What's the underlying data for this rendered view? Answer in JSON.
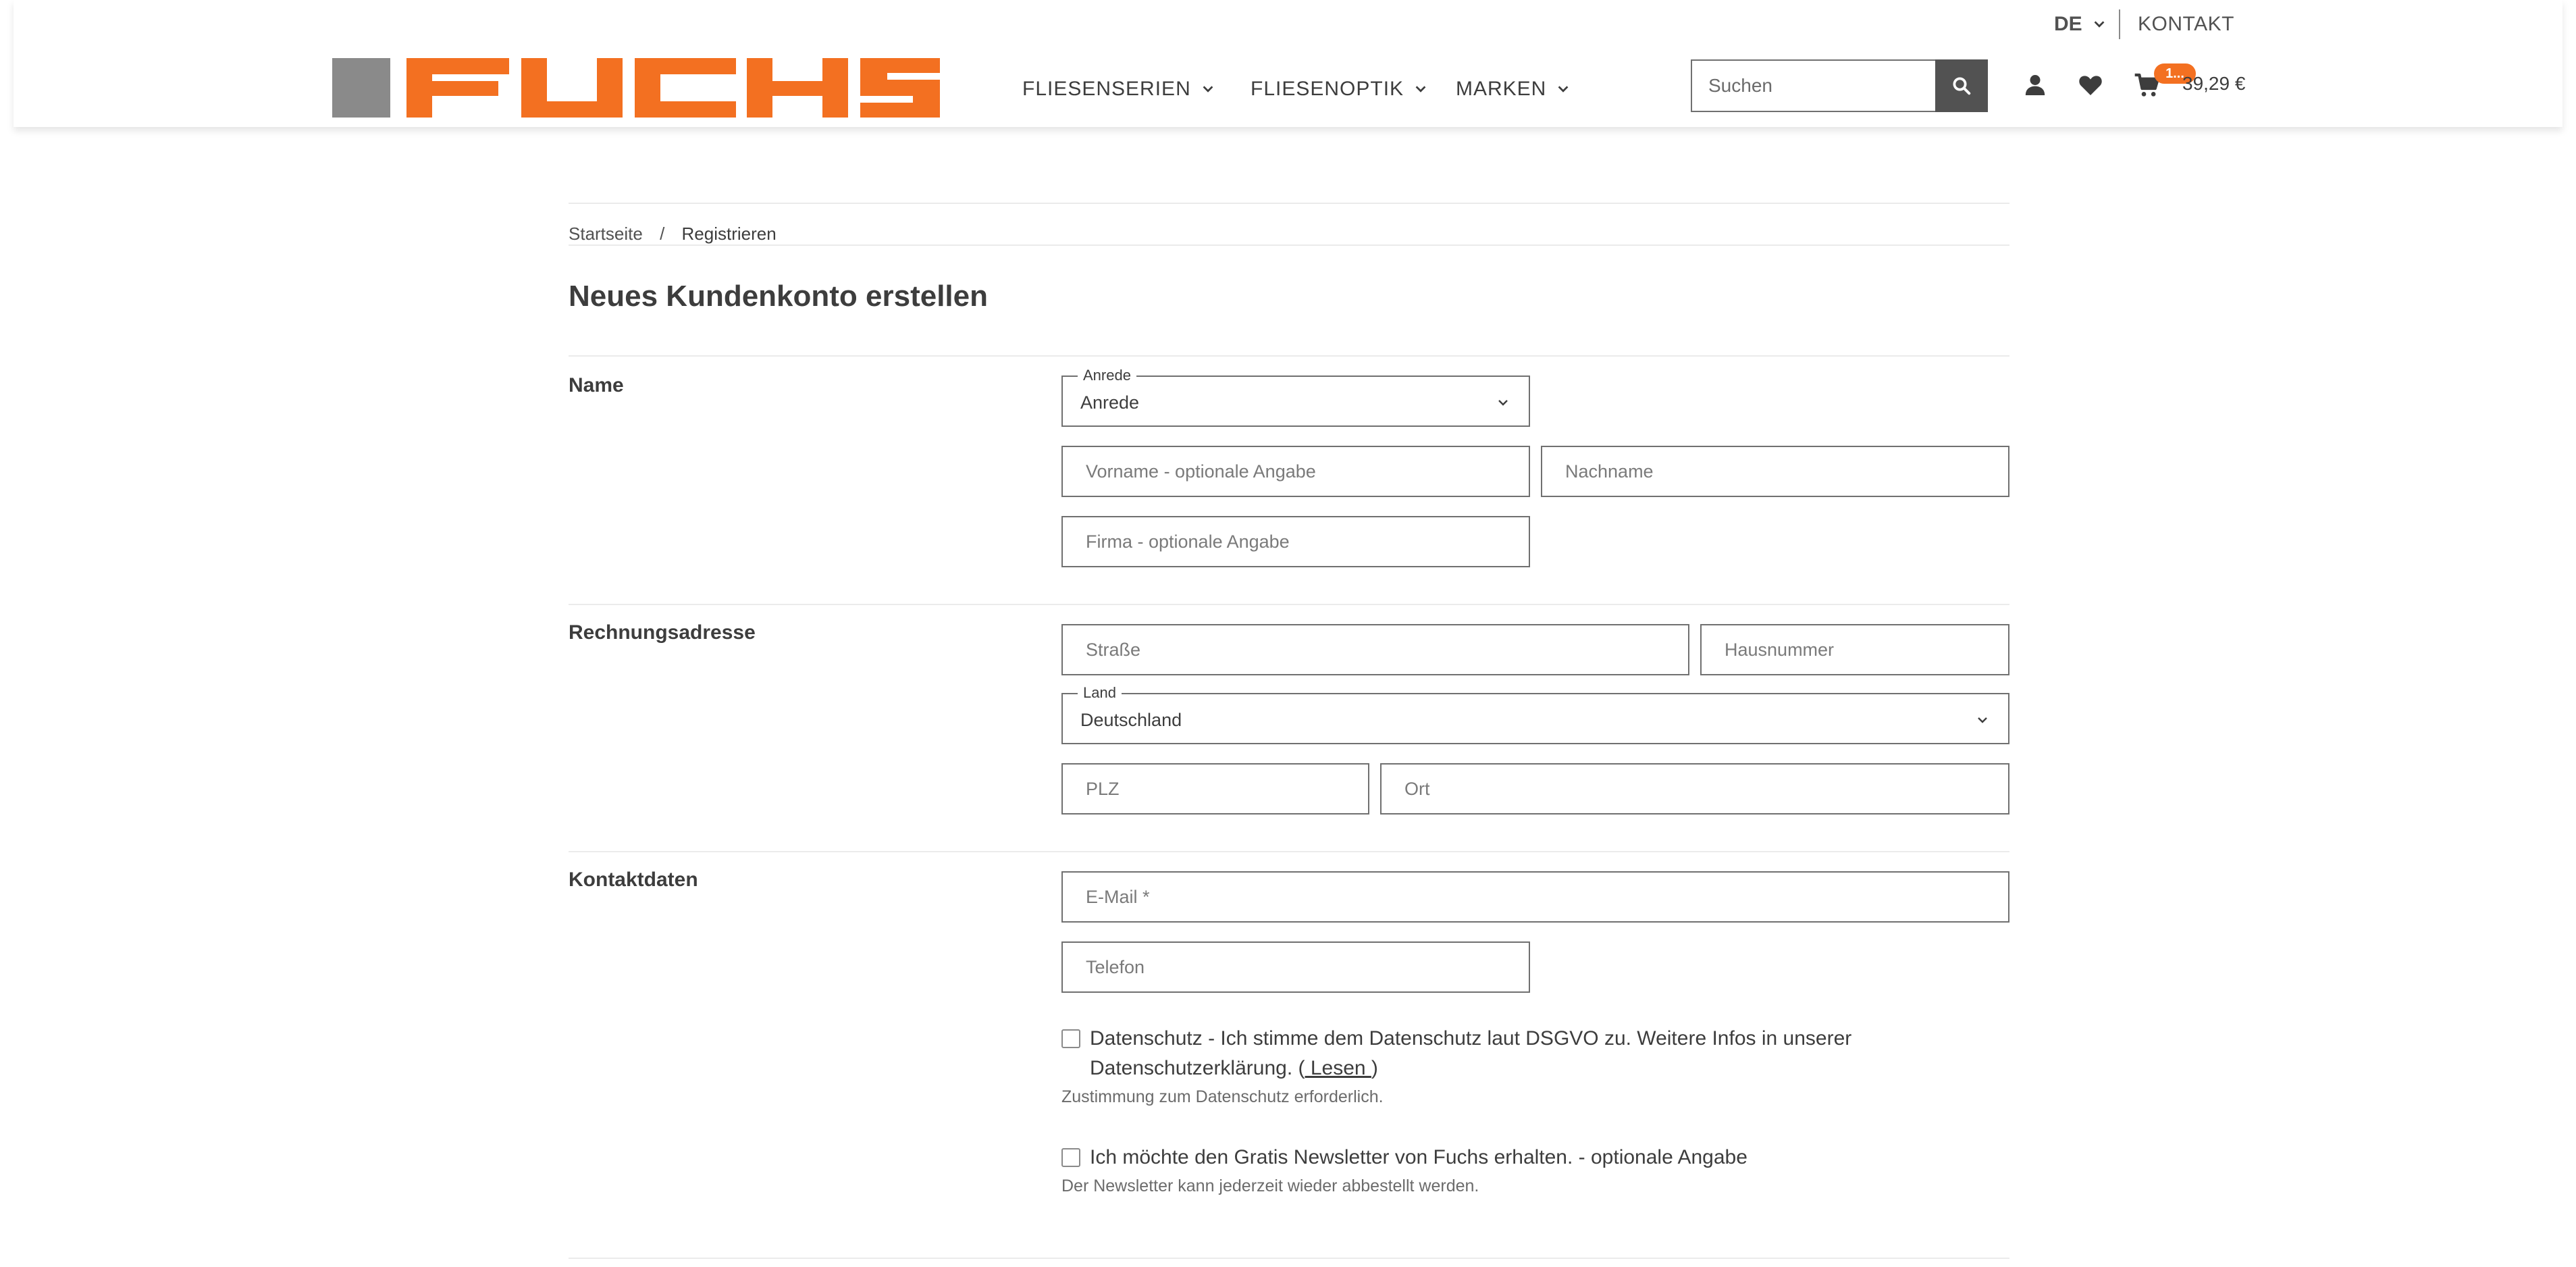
{
  "header": {
    "language": "DE",
    "contact_label": "KONTAKT",
    "brand": "FUCHS",
    "brand_color": "#f37021",
    "brand_gray": "#8a8a8a",
    "nav": [
      {
        "label": "FLIESENSERIEN",
        "icon": "chevron-down-icon"
      },
      {
        "label": "FLIESENOPTIK",
        "icon": "chevron-down-icon"
      },
      {
        "label": "MARKEN",
        "icon": "chevron-down-icon"
      }
    ],
    "search_placeholder": "Suchen",
    "icons": [
      "search-icon",
      "user-icon",
      "heart-icon",
      "cart-icon"
    ],
    "cart_badge": "1...",
    "cart_total": "39,29 €"
  },
  "breadcrumb": {
    "home": "Startseite",
    "separator": "/",
    "current": "Registrieren"
  },
  "page": {
    "title": "Neues Kundenkonto erstellen"
  },
  "sections": {
    "name": {
      "label": "Name",
      "salutation_legend": "Anrede",
      "salutation_value": "Anrede",
      "firstname_placeholder": "Vorname - optionale Angabe",
      "lastname_placeholder": "Nachname",
      "company_placeholder": "Firma - optionale Angabe"
    },
    "billing": {
      "label": "Rechnungsadresse",
      "street_placeholder": "Straße",
      "housenumber_placeholder": "Hausnummer",
      "country_legend": "Land",
      "country_value": "Deutschland",
      "zip_placeholder": "PLZ",
      "city_placeholder": "Ort"
    },
    "contact": {
      "label": "Kontaktdaten",
      "email_placeholder": "E-Mail *",
      "phone_placeholder": "Telefon",
      "privacy_text": "Datenschutz - Ich stimme dem Datenschutz laut DSGVO zu. Weitere Infos in unserer Datenschutzerklärung. (",
      "privacy_link": " Lesen ",
      "privacy_close": ")",
      "privacy_hint": "Zustimmung zum Datenschutz erforderlich.",
      "newsletter_text": "Ich möchte den Gratis Newsletter von Fuchs erhalten. - optionale Angabe",
      "newsletter_hint": "Der Newsletter kann jederzeit wieder abbestellt werden."
    }
  }
}
